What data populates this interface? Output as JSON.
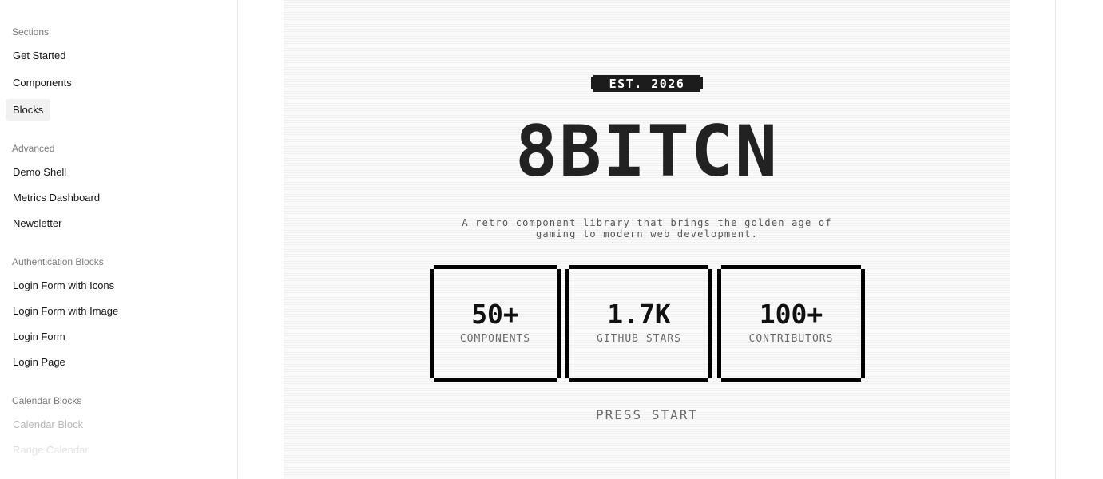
{
  "sidebar": {
    "groups": [
      {
        "title": "Sections",
        "items": [
          "Get Started",
          "Components",
          "Blocks"
        ]
      },
      {
        "title": "Advanced",
        "items": [
          "Demo Shell",
          "Metrics Dashboard",
          "Newsletter"
        ]
      },
      {
        "title": "Authentication Blocks",
        "items": [
          "Login Form with Icons",
          "Login Form with Image",
          "Login Form",
          "Login Page"
        ]
      },
      {
        "title": "Calendar Blocks",
        "items": [
          "Calendar Block",
          "Range Calendar"
        ]
      }
    ],
    "active_item": "Blocks"
  },
  "hero": {
    "badge": "EST. 2026",
    "title": "8BITCN",
    "tagline_line1": "A retro component library that brings the golden age of",
    "tagline_line2": "gaming to modern web development.",
    "stats": [
      {
        "value": "50+",
        "label": "COMPONENTS"
      },
      {
        "value": "1.7K",
        "label": "GITHUB STARS"
      },
      {
        "value": "100+",
        "label": "CONTRIBUTORS"
      }
    ],
    "cta": "PRESS START"
  },
  "colors": {
    "badge_bg": "#1c1c1c",
    "title": "#222222",
    "muted": "#6a6a6a",
    "active_bg": "#f1f1f1"
  }
}
